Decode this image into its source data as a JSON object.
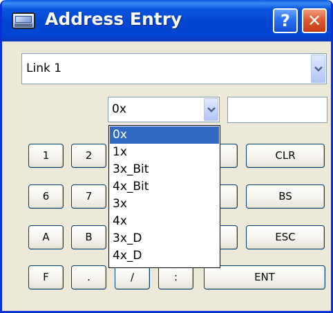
{
  "window": {
    "title": "Address Entry",
    "help_label": "?",
    "close_label": "✕"
  },
  "link_select": {
    "value": "Link 1"
  },
  "address_type_select": {
    "value": "0x"
  },
  "address_value": {
    "value": ""
  },
  "keypad": {
    "row1": [
      "1",
      "2",
      "CLR"
    ],
    "row2": [
      "6",
      "7",
      "BS"
    ],
    "row3": [
      "A",
      "B",
      "ESC"
    ],
    "row4": [
      "F",
      ".",
      "/",
      ":",
      "ENT"
    ]
  },
  "dropdown": {
    "options": [
      "0x",
      "1x",
      "3x_Bit",
      "4x_Bit",
      "3x",
      "4x",
      "3x_D",
      "4x_D"
    ],
    "selected": "0x"
  },
  "colors": {
    "titlebar": "#0346d0",
    "window_bg": "#ece9d8",
    "selection": "#316ac5",
    "close_button": "#e05b33"
  }
}
